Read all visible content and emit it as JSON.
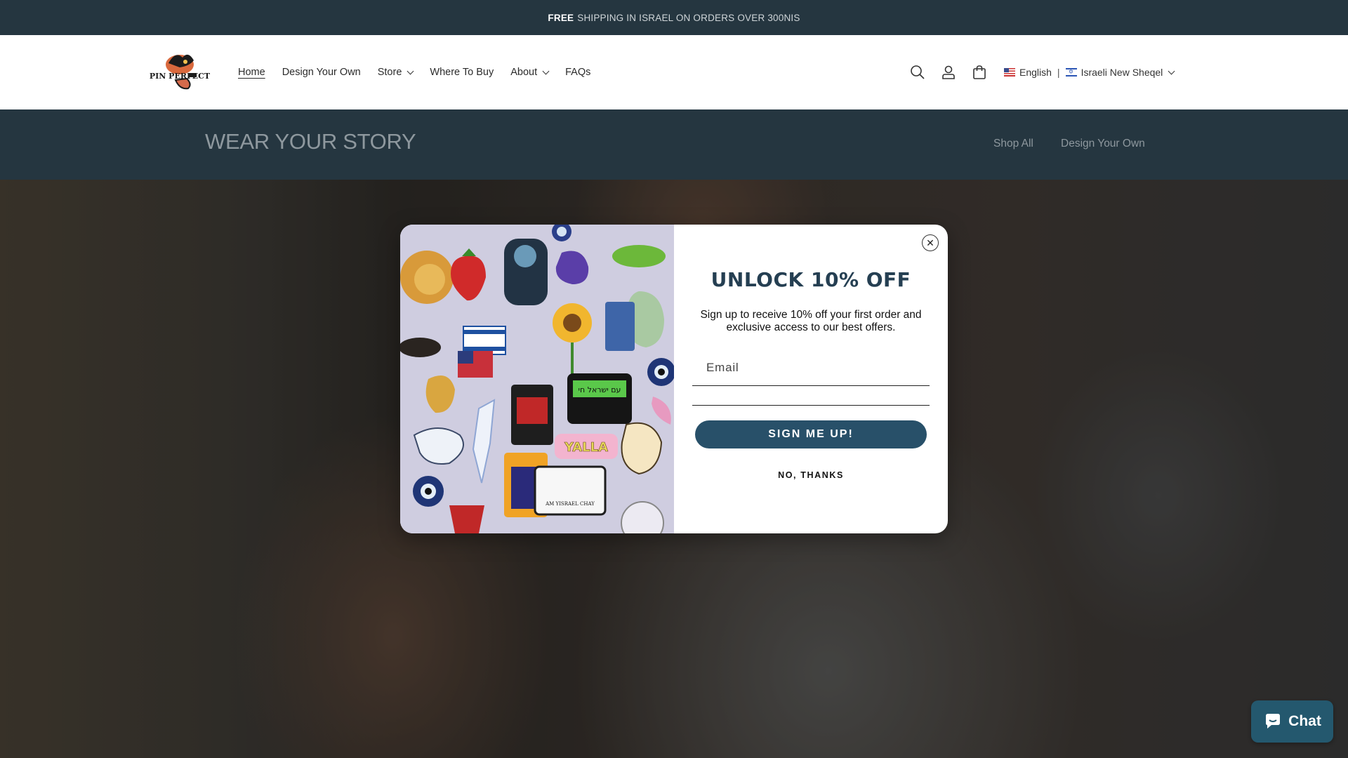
{
  "announcement": {
    "bold": "FREE",
    "text": "SHIPPING IN ISRAEL ON ORDERS OVER 300NIS"
  },
  "header": {
    "logo_text": "PIN PERFECT",
    "nav": [
      {
        "label": "Home",
        "active": true,
        "dropdown": false
      },
      {
        "label": "Design Your Own",
        "active": false,
        "dropdown": false
      },
      {
        "label": "Store",
        "active": false,
        "dropdown": true
      },
      {
        "label": "Where To Buy",
        "active": false,
        "dropdown": false
      },
      {
        "label": "About",
        "active": false,
        "dropdown": true
      },
      {
        "label": "FAQs",
        "active": false,
        "dropdown": false
      }
    ],
    "icons": [
      "search-icon",
      "account-icon",
      "cart-icon"
    ],
    "language": "English",
    "currency": "Israeli New Sheqel"
  },
  "banner": {
    "title": "WEAR YOUR STORY",
    "links": [
      "Shop All",
      "Design Your Own"
    ]
  },
  "popup": {
    "headline": "UNLOCK 10% OFF",
    "description": "Sign up to receive 10% off your first order and exclusive access to our best offers.",
    "email_placeholder": "Email",
    "submit_label": "SIGN ME UP!",
    "decline_label": "NO, THANKS",
    "close_symbol": "✕",
    "pin_texts": [
      "YALLA",
      "עם ישראל חי",
      "AM YISRAEL CHAY"
    ]
  },
  "chat": {
    "label": "Chat"
  },
  "colors": {
    "dark": "#253640",
    "button": "#285069",
    "chat": "#24586e",
    "headline": "#253f52"
  }
}
